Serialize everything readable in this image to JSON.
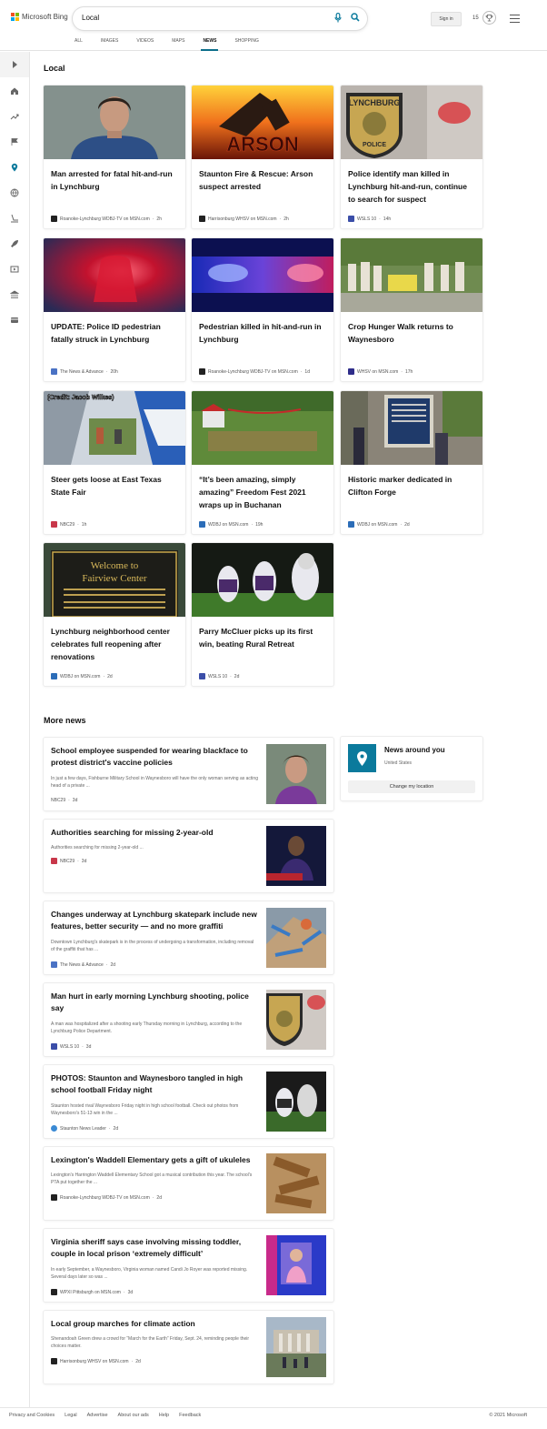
{
  "header": {
    "logo_text": "Microsoft Bing",
    "search_value": "Local",
    "signin_label": "Sign in",
    "points": "15",
    "tabs": [
      {
        "label": "ALL"
      },
      {
        "label": "IMAGES"
      },
      {
        "label": "VIDEOS"
      },
      {
        "label": "MAPS"
      },
      {
        "label": "NEWS",
        "active": true
      },
      {
        "label": "SHOPPING"
      }
    ]
  },
  "sidebar": {
    "icons": [
      "expand-icon",
      "home-icon",
      "trending-icon",
      "flag-icon",
      "location-icon",
      "globe-icon",
      "sports-icon",
      "rocket-icon",
      "video-icon",
      "bank-icon",
      "card-icon"
    ]
  },
  "local": {
    "title": "Local",
    "cards": [
      {
        "title": "Man arrested for fatal hit-and-run in Lynchburg",
        "source": "Roanoke-Lynchburg WDBJ-TV on MSN.com",
        "age": "2h"
      },
      {
        "title": "Staunton Fire & Rescue: Arson suspect arrested",
        "source": "Harrisonburg WHSV on MSN.com",
        "age": "2h"
      },
      {
        "title": "Police identify man killed in Lynchburg hit-and-run, continue to search for suspect",
        "source": "WSLS 10",
        "age": "14h"
      },
      {
        "title": "UPDATE: Police ID pedestrian fatally struck in Lynchburg",
        "source": "The News & Advance",
        "age": "20h"
      },
      {
        "title": "Pedestrian killed in hit-and-run in Lynchburg",
        "source": "Roanoke-Lynchburg WDBJ-TV on MSN.com",
        "age": "1d"
      },
      {
        "title": "Crop Hunger Walk returns to Waynesboro",
        "source": "WHSV on MSN.com",
        "age": "17h"
      },
      {
        "title": "Steer gets loose at East Texas State Fair",
        "source": "NBC29",
        "age": "1h"
      },
      {
        "title": "“It’s been amazing, simply amazing” Freedom Fest 2021 wraps up in Buchanan",
        "source": "WDBJ on MSN.com",
        "age": "19h"
      },
      {
        "title": "Historic marker dedicated in Clifton Forge",
        "source": "WDBJ on MSN.com",
        "age": "2d"
      },
      {
        "title": "Lynchburg neighborhood center celebrates full reopening after renovations",
        "source": "WDBJ on MSN.com",
        "age": "2d"
      },
      {
        "title": "Parry McCluer picks up its first win, beating Rural Retreat",
        "source": "WSLS 10",
        "age": "2d"
      }
    ],
    "image_text": {
      "arson": "ARSON",
      "police_top": "LYNCHBURG",
      "police_bottom": "POLICE",
      "credit": "(Credit: Jacob Wilkes)",
      "sign_line1": "Welcome to",
      "sign_line2": "Fairview Center"
    }
  },
  "more_news": {
    "title": "More news",
    "items": [
      {
        "title": "School employee suspended for wearing blackface to protest district's vaccine policies",
        "snippet": "In just a few days, Fishburne Military School in Waynesboro will have the only woman serving as acting head of a private ...",
        "source": "NBC29",
        "age": "3d"
      },
      {
        "title": "Authorities searching for missing 2-year-old",
        "snippet": "Authorities searching for missing 2-year-old ...",
        "source": "NBC29",
        "age": "3d"
      },
      {
        "title": "Changes underway at Lynchburg skatepark include new features, better security — and no more graffiti",
        "snippet": "Downtown Lynchburg's skatepark is in the process of undergoing a transformation, including removal of the graffiti that has ...",
        "source": "The News & Advance",
        "age": "2d"
      },
      {
        "title": "Man hurt in early morning Lynchburg shooting, police say",
        "snippet": "A man was hospitalized after a shooting early Thursday morning in Lynchburg, according to the Lynchburg Police Department.",
        "source": "WSLS 10",
        "age": "3d"
      },
      {
        "title": "PHOTOS: Staunton and Waynesboro tangled in high school football Friday night",
        "snippet": "Staunton hosted rival Waynesboro Friday night in high school football. Check out photos from Waynesboro's 51-13 win in the ...",
        "source": "Staunton News Leader",
        "age": "2d"
      },
      {
        "title": "Lexington's Waddell Elementary gets a gift of ukuleles",
        "snippet": "Lexington's Harrington Waddell Elementary School got a musical contribution this year. The school's PTA put together the ...",
        "source": "Roanoke-Lynchburg WDBJ-TV on MSN.com",
        "age": "2d"
      },
      {
        "title": "Virginia sheriff says case involving missing toddler, couple in local prison ‘extremely difficult’",
        "snippet": "In early September, a Waynesboro, Virginia woman named Candi Jo Royer was reported missing. Several days later so was ...",
        "source": "WPXI Pittsburgh on MSN.com",
        "age": "3d"
      },
      {
        "title": "Local group marches for climate action",
        "snippet": "Shenandoah Green drew a crowd for “March for the Earth” Friday, Sept. 24, reminding people their choices matter.",
        "source": "Harrisonburg WHSV on MSN.com",
        "age": "2d"
      }
    ]
  },
  "news_around": {
    "title": "News around you",
    "location": "United States",
    "button": "Change my location"
  },
  "footer": {
    "links": [
      "Privacy and Cookies",
      "Legal",
      "Advertise",
      "About our ads",
      "Help",
      "Feedback"
    ],
    "copyright": "© 2021 Microsoft"
  },
  "colors": {
    "accent": "#0b6e8a"
  }
}
